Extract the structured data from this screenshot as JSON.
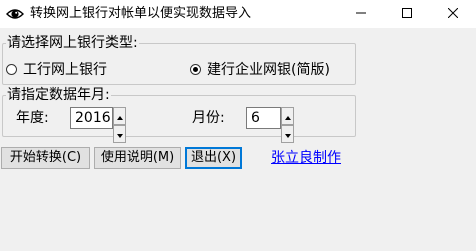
{
  "window": {
    "title": "转换网上银行对帐单以便实现数据导入"
  },
  "bank_type": {
    "legend": "请选择网上银行类型:",
    "options": [
      {
        "label": "工行网上银行",
        "selected": false
      },
      {
        "label": "建行企业网银(简版)",
        "selected": true
      }
    ]
  },
  "period": {
    "legend": "请指定数据年月:",
    "year_label": "年度:",
    "year_value": "2016",
    "month_label": "月份:",
    "month_value": "6"
  },
  "buttons": {
    "start": "开始转换(C)",
    "help": "使用说明(M)",
    "exit": "退出(X)"
  },
  "credit_link": "张立良制作",
  "colors": {
    "link": "#0000ff",
    "focus": "#0078d7",
    "background": "#f0f0f0"
  }
}
